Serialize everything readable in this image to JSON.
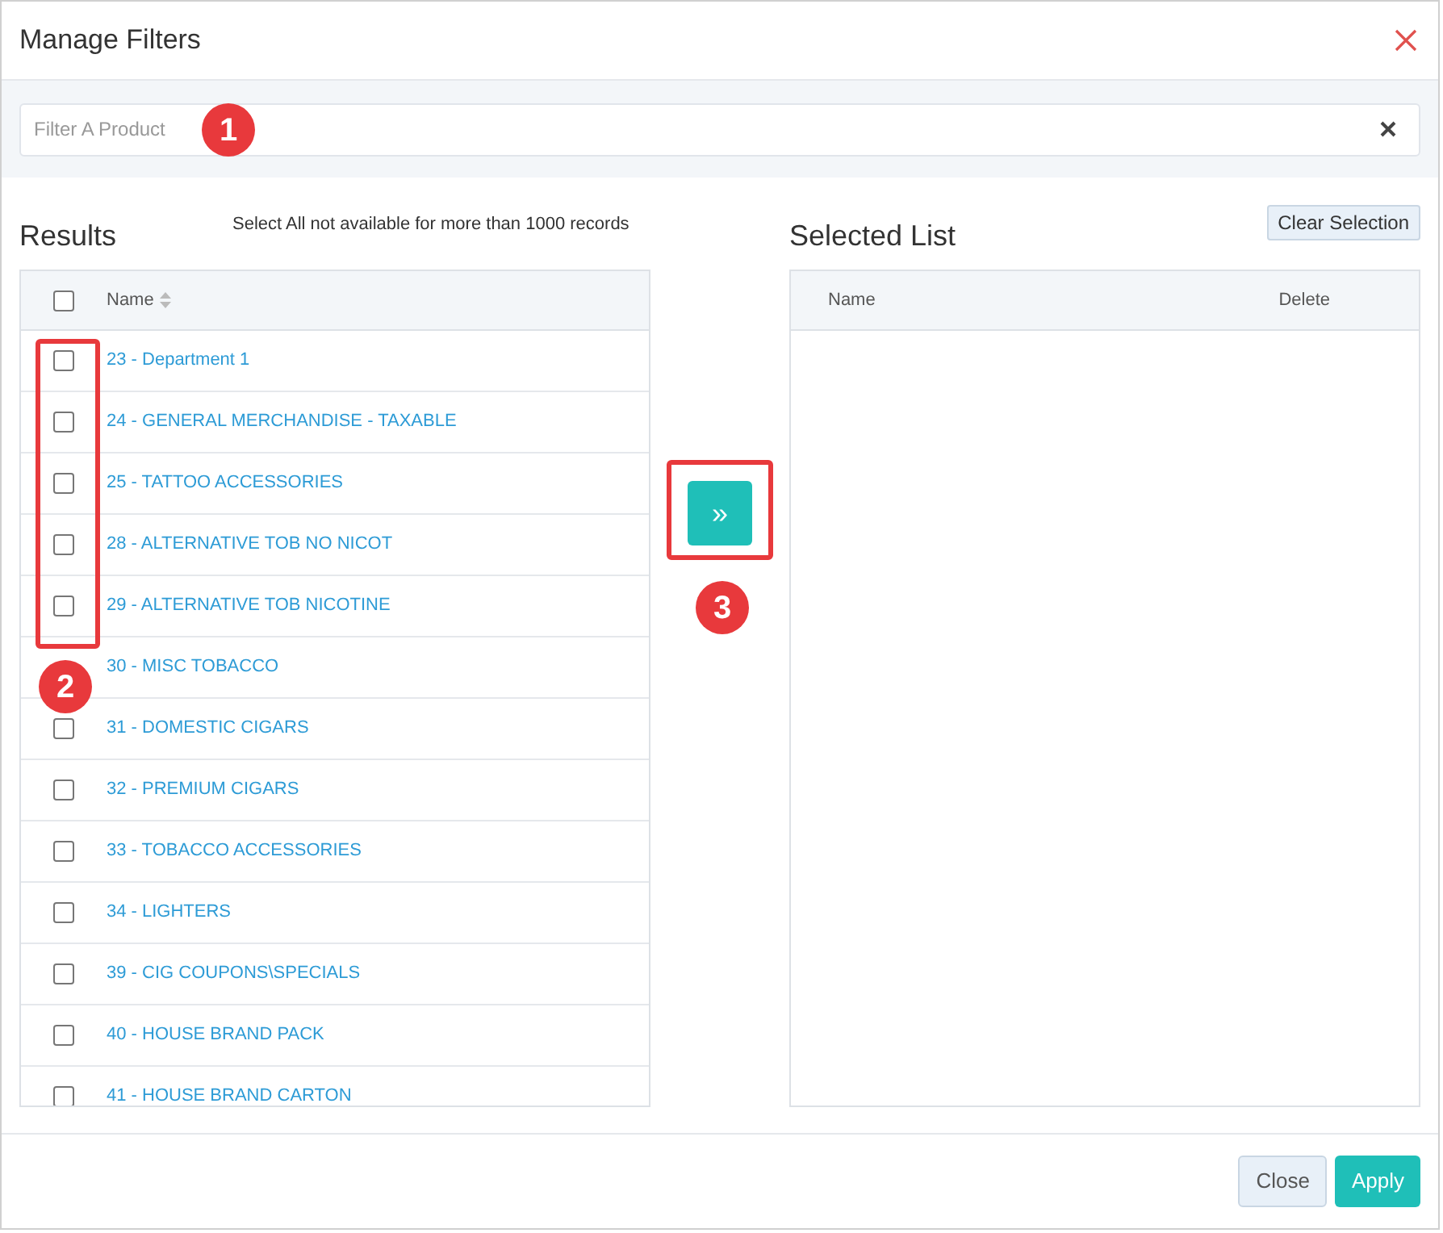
{
  "dialog": {
    "title": "Manage Filters"
  },
  "search": {
    "placeholder": "Filter A Product"
  },
  "results": {
    "title": "Results",
    "note": "Select All not available for more than 1000 records",
    "select_all_checked": false,
    "columns": [
      "Name"
    ],
    "rows": [
      {
        "kind": "checkbox",
        "checked": false,
        "name": "23 - Department 1"
      },
      {
        "kind": "checkbox",
        "checked": false,
        "name": "24 - GENERAL MERCHANDISE - TAXABLE"
      },
      {
        "kind": "checkbox",
        "checked": false,
        "name": "25 - TATTOO ACCESSORIES"
      },
      {
        "kind": "checkbox",
        "checked": false,
        "name": "28 - ALTERNATIVE TOB NO NICOT"
      },
      {
        "kind": "checkbox",
        "checked": false,
        "name": "29 - ALTERNATIVE TOB NICOTINE"
      },
      {
        "kind": "covered",
        "name": "30 - MISC TOBACCO"
      },
      {
        "kind": "checkbox",
        "checked": false,
        "name": "31 - DOMESTIC CIGARS"
      },
      {
        "kind": "checkbox",
        "checked": false,
        "name": "32 - PREMIUM CIGARS"
      },
      {
        "kind": "checkbox",
        "checked": false,
        "name": "33 - TOBACCO ACCESSORIES"
      },
      {
        "kind": "checkbox",
        "checked": false,
        "name": "34 - LIGHTERS"
      },
      {
        "kind": "checkbox",
        "checked": false,
        "name": "39 - CIG COUPONS\\SPECIALS"
      },
      {
        "kind": "checkbox",
        "checked": false,
        "name": "40 - HOUSE BRAND PACK"
      },
      {
        "kind": "checkbox",
        "checked": false,
        "name": "41 - HOUSE BRAND CARTON"
      }
    ]
  },
  "move_button": {
    "label": "»"
  },
  "selected": {
    "title": "Selected List",
    "clear_button": "Clear Selection",
    "columns": [
      "Name",
      "Delete"
    ]
  },
  "callouts": [
    "1",
    "2",
    "3"
  ],
  "footer": {
    "buttons": [
      "Close",
      "Apply"
    ]
  }
}
